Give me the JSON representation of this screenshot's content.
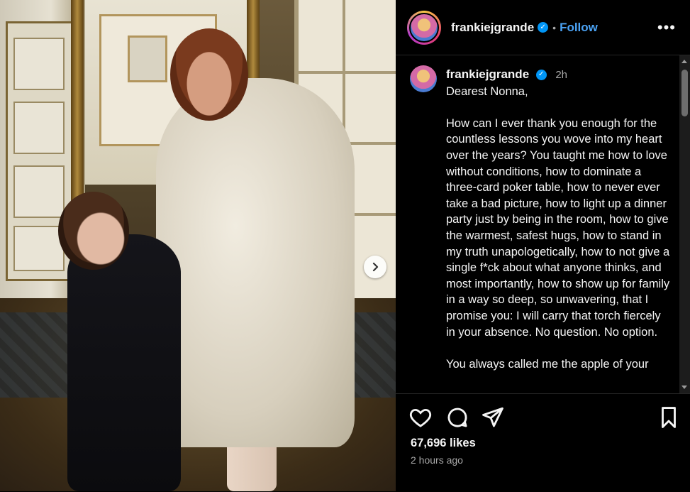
{
  "post": {
    "username": "frankiejgrande",
    "follow_label": "Follow",
    "separator": "•",
    "verified_mark": "✓",
    "more_label": "•••"
  },
  "caption": {
    "username": "frankiejgrande",
    "time": "2h",
    "paragraphs": [
      "Dearest Nonna,",
      "How can I ever thank you enough for the countless lessons you wove into my heart over the years? You taught me how to love without conditions, how to dominate a three-card poker table, how to never ever take a bad picture, how to light up a dinner party just by being in the room, how to give the warmest, safest hugs, how to stand in my truth unapologetically, how to not give a single f*ck about what anyone thinks, and most importantly, how to show up for family in a way so deep, so unwavering, that I promise you: I will carry that torch fiercely in your absence. No question. No option.",
      "You always called me the apple of your"
    ]
  },
  "stats": {
    "likes": "67,696 likes",
    "time_ago": "2 hours ago"
  },
  "icons": {
    "like": "heart-icon",
    "comment": "comment-icon",
    "share": "send-icon",
    "save": "bookmark-icon",
    "next": "chevron-right-icon",
    "more": "more-options-icon"
  },
  "colors": {
    "background": "#000000",
    "follow": "#4ba3f5",
    "verified": "#0095f6",
    "muted": "#a8a8a8"
  }
}
